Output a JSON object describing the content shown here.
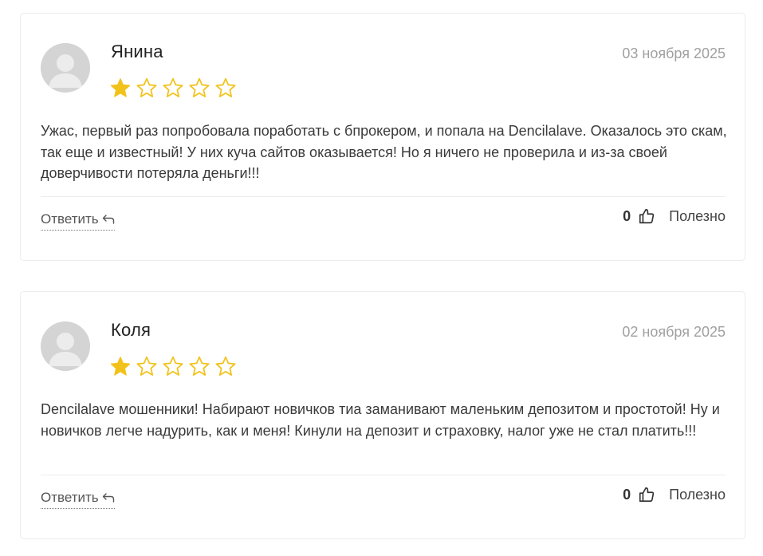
{
  "reviews": [
    {
      "name": "Янина",
      "date": "03 ноября 2025",
      "rating": 1,
      "max_rating": 5,
      "text": "Ужас, первый раз попробовала поработать с бпрокером, и попала на Dencilalave. Оказалось это скам, так еще и известный! У них куча сайтов оказывается! Но я ничего не проверила и из-за своей доверчивости потеряла деньги!!!",
      "reply_label": "Ответить",
      "helpful_count": "0",
      "helpful_label": "Полезно"
    },
    {
      "name": "Коля",
      "date": "02 ноября 2025",
      "rating": 1,
      "max_rating": 5,
      "text": "Dencilalave мошенники! Набирают новичков тиа заманивают маленьким депозитом и простотой! Ну и новичков легче надурить, как и меня! Кинули на депозит и страховку, налог уже не стал платить!!!",
      "reply_label": "Ответить",
      "helpful_count": "0",
      "helpful_label": "Полезно"
    }
  ],
  "colors": {
    "star_filled": "#f2c21b",
    "star_empty_stroke": "#f2c21b",
    "date": "#a0a0a0",
    "avatar_bg": "#d9d9d9"
  }
}
